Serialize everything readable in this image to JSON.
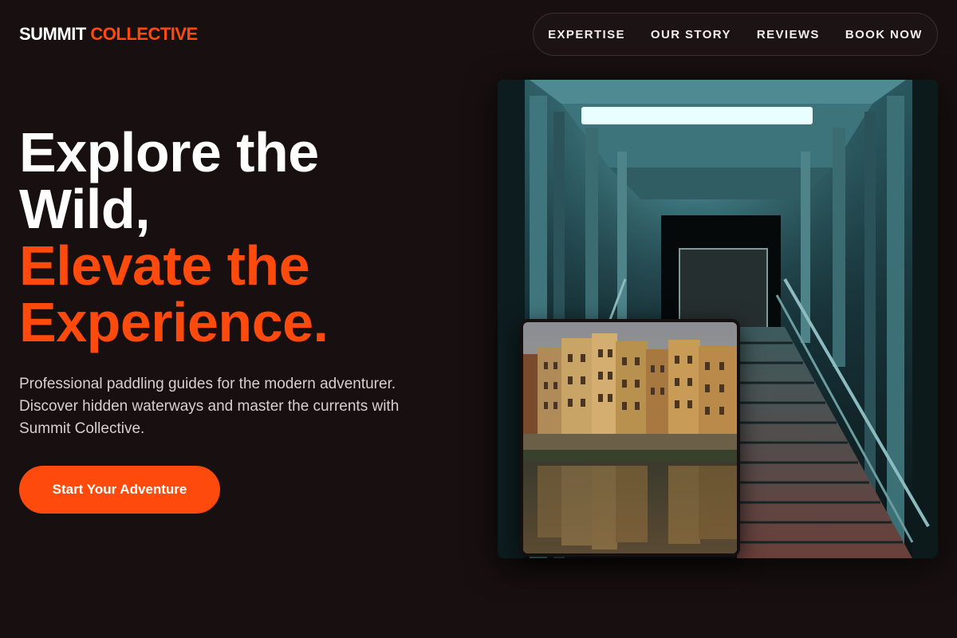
{
  "brand": {
    "name_part1": "SUMMIT",
    "name_part2": "COLLECTIVE"
  },
  "nav": {
    "items": [
      {
        "label": "EXPERTISE"
      },
      {
        "label": "OUR STORY"
      },
      {
        "label": "REVIEWS"
      },
      {
        "label": "BOOK NOW"
      }
    ]
  },
  "hero": {
    "headline_line1": "Explore the",
    "headline_line2": "Wild,",
    "headline_line3": "Elevate the",
    "headline_line4": "Experience.",
    "tagline": "Professional paddling guides for the modern adventurer. Discover hidden waterways and master the currents with Summit Collective.",
    "cta_label": "Start Your Adventure"
  },
  "colors": {
    "background": "#170f10",
    "accent": "#ff4a0d",
    "text": "#ffffff",
    "muted_text": "#d6d0d1"
  },
  "images": {
    "main": {
      "subject": "illuminated steel stairway bridge at night"
    },
    "inset": {
      "subject": "riverside buildings reflected in water"
    }
  }
}
